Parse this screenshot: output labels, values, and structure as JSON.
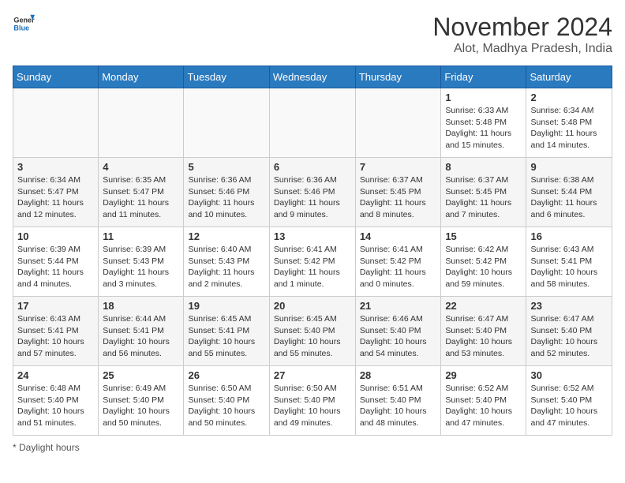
{
  "header": {
    "logo_general": "General",
    "logo_blue": "Blue",
    "month_title": "November 2024",
    "subtitle": "Alot, Madhya Pradesh, India"
  },
  "calendar": {
    "days_of_week": [
      "Sunday",
      "Monday",
      "Tuesday",
      "Wednesday",
      "Thursday",
      "Friday",
      "Saturday"
    ],
    "weeks": [
      [
        {
          "day": "",
          "info": ""
        },
        {
          "day": "",
          "info": ""
        },
        {
          "day": "",
          "info": ""
        },
        {
          "day": "",
          "info": ""
        },
        {
          "day": "",
          "info": ""
        },
        {
          "day": "1",
          "info": "Sunrise: 6:33 AM\nSunset: 5:48 PM\nDaylight: 11 hours and 15 minutes."
        },
        {
          "day": "2",
          "info": "Sunrise: 6:34 AM\nSunset: 5:48 PM\nDaylight: 11 hours and 14 minutes."
        }
      ],
      [
        {
          "day": "3",
          "info": "Sunrise: 6:34 AM\nSunset: 5:47 PM\nDaylight: 11 hours and 12 minutes."
        },
        {
          "day": "4",
          "info": "Sunrise: 6:35 AM\nSunset: 5:47 PM\nDaylight: 11 hours and 11 minutes."
        },
        {
          "day": "5",
          "info": "Sunrise: 6:36 AM\nSunset: 5:46 PM\nDaylight: 11 hours and 10 minutes."
        },
        {
          "day": "6",
          "info": "Sunrise: 6:36 AM\nSunset: 5:46 PM\nDaylight: 11 hours and 9 minutes."
        },
        {
          "day": "7",
          "info": "Sunrise: 6:37 AM\nSunset: 5:45 PM\nDaylight: 11 hours and 8 minutes."
        },
        {
          "day": "8",
          "info": "Sunrise: 6:37 AM\nSunset: 5:45 PM\nDaylight: 11 hours and 7 minutes."
        },
        {
          "day": "9",
          "info": "Sunrise: 6:38 AM\nSunset: 5:44 PM\nDaylight: 11 hours and 6 minutes."
        }
      ],
      [
        {
          "day": "10",
          "info": "Sunrise: 6:39 AM\nSunset: 5:44 PM\nDaylight: 11 hours and 4 minutes."
        },
        {
          "day": "11",
          "info": "Sunrise: 6:39 AM\nSunset: 5:43 PM\nDaylight: 11 hours and 3 minutes."
        },
        {
          "day": "12",
          "info": "Sunrise: 6:40 AM\nSunset: 5:43 PM\nDaylight: 11 hours and 2 minutes."
        },
        {
          "day": "13",
          "info": "Sunrise: 6:41 AM\nSunset: 5:42 PM\nDaylight: 11 hours and 1 minute."
        },
        {
          "day": "14",
          "info": "Sunrise: 6:41 AM\nSunset: 5:42 PM\nDaylight: 11 hours and 0 minutes."
        },
        {
          "day": "15",
          "info": "Sunrise: 6:42 AM\nSunset: 5:42 PM\nDaylight: 10 hours and 59 minutes."
        },
        {
          "day": "16",
          "info": "Sunrise: 6:43 AM\nSunset: 5:41 PM\nDaylight: 10 hours and 58 minutes."
        }
      ],
      [
        {
          "day": "17",
          "info": "Sunrise: 6:43 AM\nSunset: 5:41 PM\nDaylight: 10 hours and 57 minutes."
        },
        {
          "day": "18",
          "info": "Sunrise: 6:44 AM\nSunset: 5:41 PM\nDaylight: 10 hours and 56 minutes."
        },
        {
          "day": "19",
          "info": "Sunrise: 6:45 AM\nSunset: 5:41 PM\nDaylight: 10 hours and 55 minutes."
        },
        {
          "day": "20",
          "info": "Sunrise: 6:45 AM\nSunset: 5:40 PM\nDaylight: 10 hours and 55 minutes."
        },
        {
          "day": "21",
          "info": "Sunrise: 6:46 AM\nSunset: 5:40 PM\nDaylight: 10 hours and 54 minutes."
        },
        {
          "day": "22",
          "info": "Sunrise: 6:47 AM\nSunset: 5:40 PM\nDaylight: 10 hours and 53 minutes."
        },
        {
          "day": "23",
          "info": "Sunrise: 6:47 AM\nSunset: 5:40 PM\nDaylight: 10 hours and 52 minutes."
        }
      ],
      [
        {
          "day": "24",
          "info": "Sunrise: 6:48 AM\nSunset: 5:40 PM\nDaylight: 10 hours and 51 minutes."
        },
        {
          "day": "25",
          "info": "Sunrise: 6:49 AM\nSunset: 5:40 PM\nDaylight: 10 hours and 50 minutes."
        },
        {
          "day": "26",
          "info": "Sunrise: 6:50 AM\nSunset: 5:40 PM\nDaylight: 10 hours and 50 minutes."
        },
        {
          "day": "27",
          "info": "Sunrise: 6:50 AM\nSunset: 5:40 PM\nDaylight: 10 hours and 49 minutes."
        },
        {
          "day": "28",
          "info": "Sunrise: 6:51 AM\nSunset: 5:40 PM\nDaylight: 10 hours and 48 minutes."
        },
        {
          "day": "29",
          "info": "Sunrise: 6:52 AM\nSunset: 5:40 PM\nDaylight: 10 hours and 47 minutes."
        },
        {
          "day": "30",
          "info": "Sunrise: 6:52 AM\nSunset: 5:40 PM\nDaylight: 10 hours and 47 minutes."
        }
      ]
    ]
  },
  "footer": {
    "note": "Daylight hours"
  }
}
